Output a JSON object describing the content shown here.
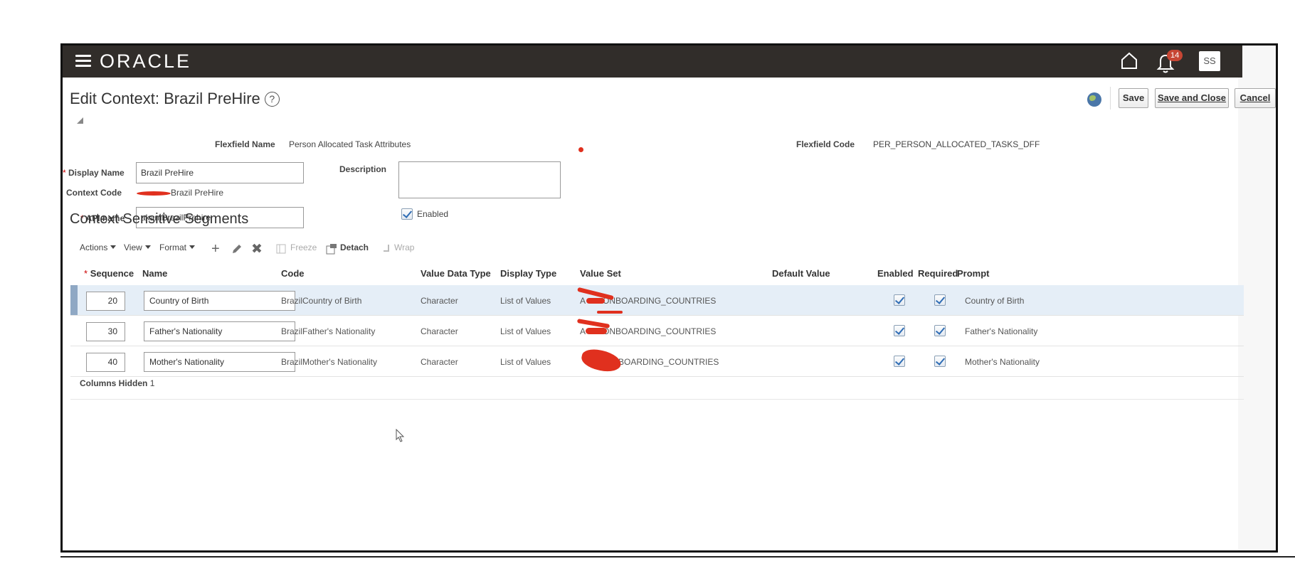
{
  "header": {
    "logo": "ORACLE",
    "notification_count": "14",
    "user_initials": "SS"
  },
  "page": {
    "title": "Edit Context: Brazil PreHire",
    "help_icon": "?"
  },
  "actions": {
    "save": "Save",
    "save_and_close": "Save and Close",
    "cancel": "Cancel"
  },
  "form": {
    "flexfield_name_label": "Flexfield Name",
    "flexfield_name_value": "Person Allocated Task Attributes",
    "flexfield_code_label": "Flexfield Code",
    "flexfield_code_value": "PER_PERSON_ALLOCATED_TASKS_DFF",
    "display_name_label": "Display Name",
    "display_name_value": "Brazil PreHire",
    "description_label": "Description",
    "description_value": "",
    "context_code_label": "Context Code",
    "context_code_value": "Brazil PreHire",
    "api_name_label": "API name",
    "api_name_value": "akamBrazilPrehire",
    "enabled_label": "Enabled",
    "enabled_checked": true,
    "required_marker": "*"
  },
  "segments": {
    "section_title": "Context Sensitive Segments",
    "toolbar": {
      "actions": "Actions",
      "view": "View",
      "format": "Format",
      "freeze": "Freeze",
      "detach": "Detach",
      "wrap": "Wrap"
    },
    "columns": [
      "Sequence",
      "Name",
      "Code",
      "Value Data Type",
      "Display Type",
      "Value Set",
      "Default Value",
      "Enabled",
      "Required",
      "Prompt"
    ],
    "rows": [
      {
        "sequence": "20",
        "name": "Country of Birth",
        "code": "BrazilCountry of Birth",
        "value_data_type": "Character",
        "display_type": "List of Values",
        "value_set": "ONBOARDING_COUNTRIES",
        "value_set_prefix": "A",
        "default_value": "",
        "enabled": true,
        "required": true,
        "prompt": "Country of Birth",
        "selected": true
      },
      {
        "sequence": "30",
        "name": "Father's Nationality",
        "code": "BrazilFather's Nationality",
        "value_data_type": "Character",
        "display_type": "List of Values",
        "value_set": "ONBOARDING_COUNTRIES",
        "value_set_prefix": "A",
        "default_value": "",
        "enabled": true,
        "required": true,
        "prompt": "Father's Nationality",
        "selected": false
      },
      {
        "sequence": "40",
        "name": "Mother's Nationality",
        "code": "BrazilMother's Nationality",
        "value_data_type": "Character",
        "display_type": "List of Values",
        "value_set": "BOARDING_COUNTRIES",
        "value_set_prefix": "",
        "default_value": "",
        "enabled": true,
        "required": true,
        "prompt": "Mother's Nationality",
        "selected": false
      }
    ],
    "columns_hidden_label": "Columns Hidden",
    "columns_hidden_count": "1"
  },
  "colors": {
    "topbar": "#312d2a",
    "selected_row": "#e5eef7",
    "redaction": "#e0301e",
    "badge": "#c74634"
  }
}
